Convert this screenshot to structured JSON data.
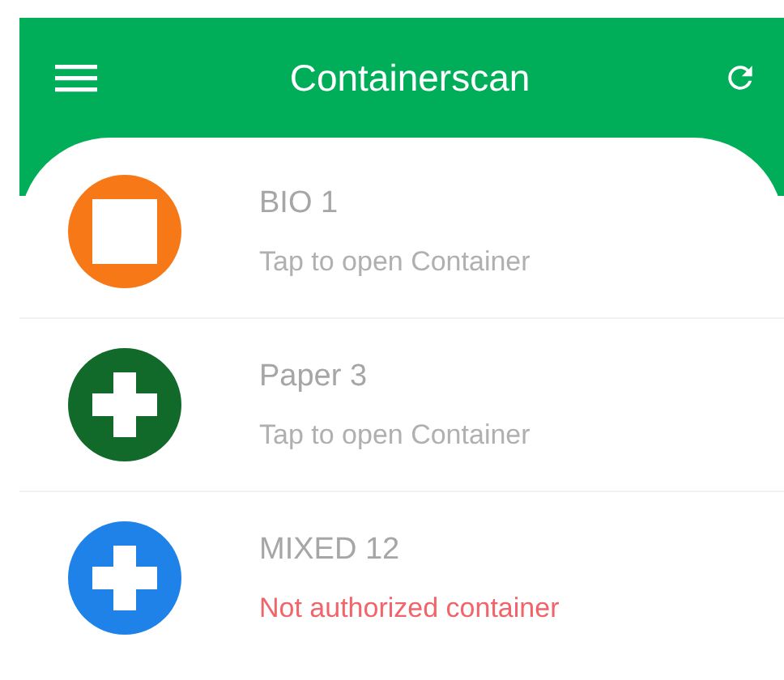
{
  "app_bar": {
    "title": "Containerscan"
  },
  "containers": [
    {
      "name": "BIO 1",
      "subtitle": "Tap to open Container",
      "color": "#f77817",
      "kind": "square",
      "authorized": true
    },
    {
      "name": "Paper 3",
      "subtitle": "Tap to open Container",
      "color": "#11692a",
      "kind": "cross",
      "authorized": true
    },
    {
      "name": "MIXED 12",
      "subtitle": "Not authorized container",
      "color": "#1e82e8",
      "kind": "cross",
      "authorized": false
    }
  ]
}
